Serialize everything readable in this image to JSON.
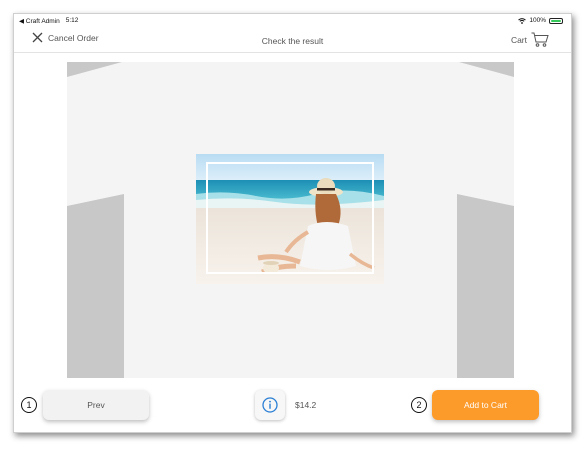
{
  "status_bar": {
    "back_app": "◀ Craft Admin",
    "time": "5:12",
    "battery": "100%"
  },
  "nav": {
    "cancel_label": "Cancel Order",
    "title": "Check the result",
    "cart_label": "Cart"
  },
  "footer": {
    "step1": "1",
    "prev_label": "Prev",
    "price": "$14.2",
    "step2": "2",
    "add_to_cart_label": "Add to Cart"
  },
  "colors": {
    "accent": "#fc9a2a",
    "info_icon": "#2b7fd4",
    "sleeve": "#c8c8c8",
    "shirt": "#f4f4f4"
  }
}
